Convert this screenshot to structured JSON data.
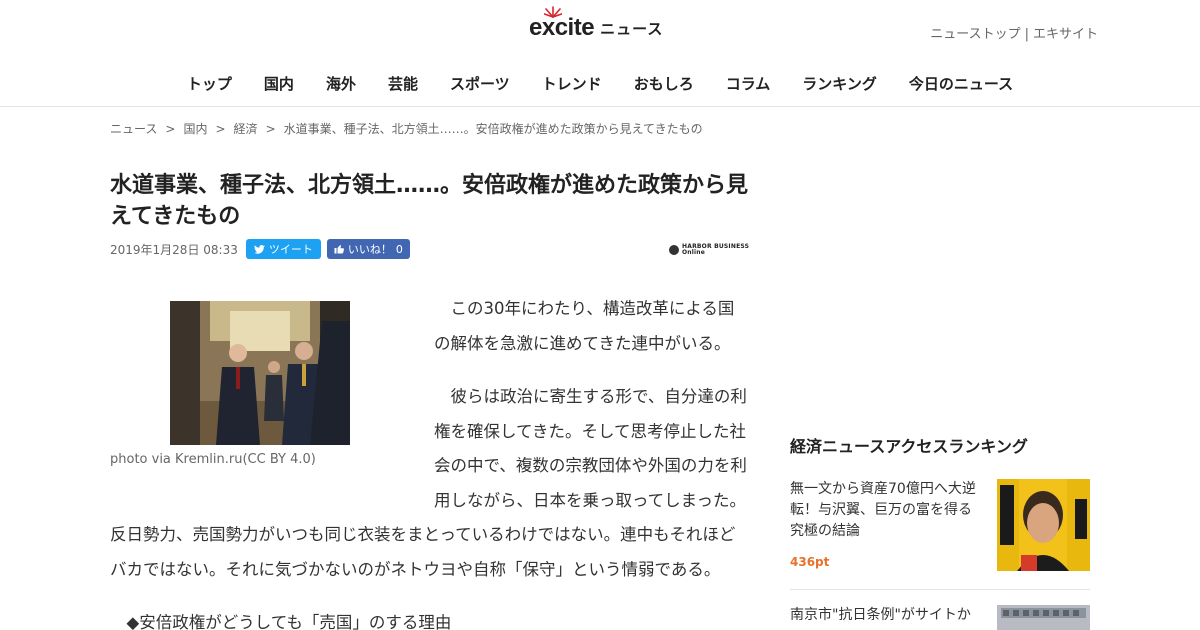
{
  "header": {
    "logo_text": "excite",
    "logo_suffix": "ニュース",
    "top_links": [
      "ニューストップ",
      "エキサイト"
    ],
    "top_sep": "|"
  },
  "nav": {
    "items": [
      "トップ",
      "国内",
      "海外",
      "芸能",
      "スポーツ",
      "トレンド",
      "おもしろ",
      "コラム",
      "ランキング",
      "今日のニュース"
    ]
  },
  "breadcrumb": {
    "items": [
      "ニュース",
      "国内",
      "経済",
      "水道事業、種子法、北方領土……。安倍政権が進めた政策から見えてきたもの"
    ],
    "sep": ">"
  },
  "article": {
    "title": "水道事業、種子法、北方領土……。安倍政権が進めた政策から見えてきたもの",
    "date": "2019年1月28日 08:33",
    "tweet_label": "ツイート",
    "like_label": "いいね！",
    "like_count": "0",
    "source_name": "HARBOR BUSINESS",
    "source_sub": "Online",
    "photo_caption": "photo via Kremlin.ru(CC BY 4.0)",
    "paragraphs": [
      "この30年にわたり、構造改革による国の解体を急激に進めてきた連中がいる。",
      "彼らは政治に寄生する形で、自分達の利権を確保してきた。そして思考停止した社会の中で、複数の宗教団体や外国の力を利用しながら、日本を乗っ取ってしまった。反日勢力、売国勢力がいつも同じ衣装をまとっているわけではない。連中もそれほどバカではない。それに気づかないのがネトウヨや自称「保守」という情弱である。",
      "◆安倍政権がどうしても「売国」のする理由"
    ]
  },
  "sidebar": {
    "ranking_title": "経済ニュースアクセスランキング",
    "items": [
      {
        "title": "無一文から資産70億円へ大逆転！与沢翼、巨万の富を得る究極の結論",
        "points": "436pt"
      },
      {
        "title": "南京市\"抗日条例\"がサイトか",
        "points": ""
      }
    ]
  },
  "colors": {
    "tweet": "#1da1f2",
    "like": "#4267b2",
    "points": "#e8712b",
    "logo_burst": "#d7262c"
  }
}
